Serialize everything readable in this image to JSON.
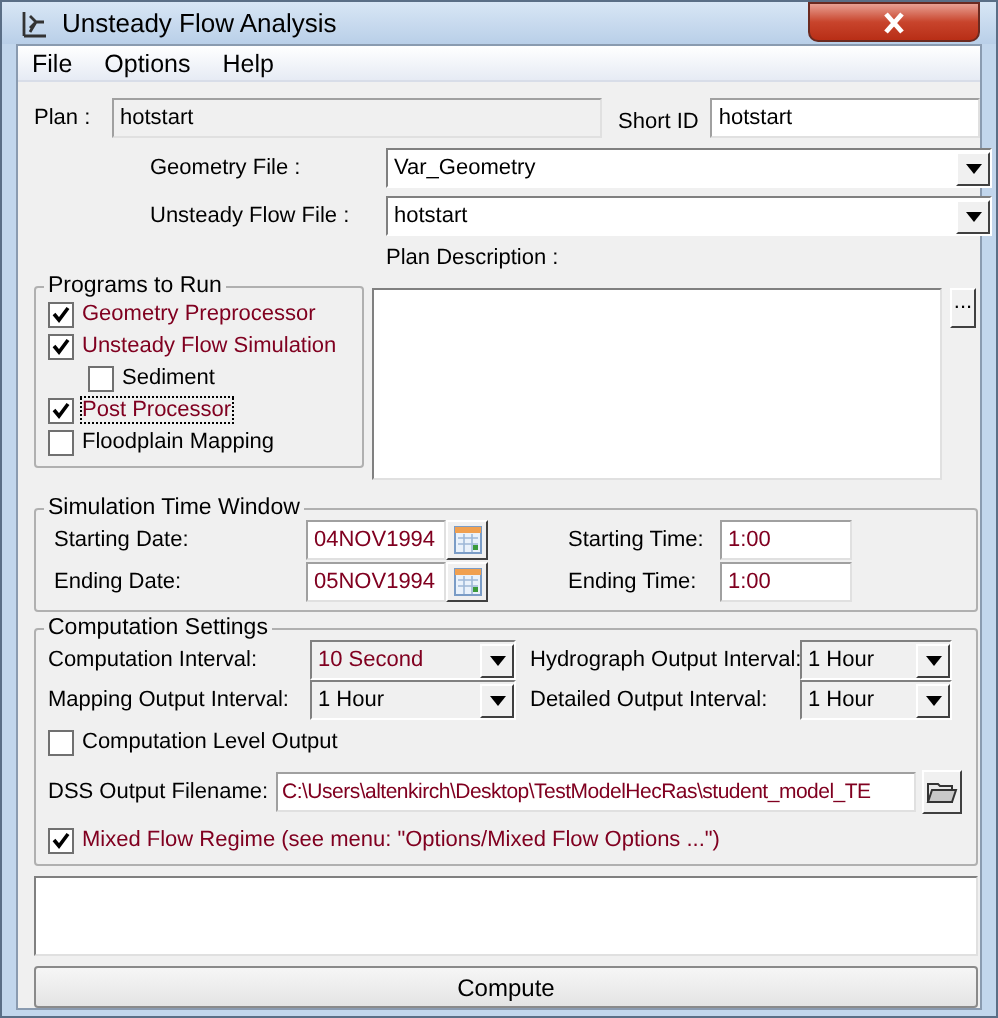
{
  "window": {
    "title": "Unsteady Flow Analysis"
  },
  "menu": [
    "File",
    "Options",
    "Help"
  ],
  "plan": {
    "label": "Plan :",
    "value": "hotstart",
    "short_id_label": "Short ID",
    "short_id": "hotstart"
  },
  "files": [
    {
      "label": "Geometry File :",
      "value": "Var_Geometry"
    },
    {
      "label": "Unsteady Flow File :",
      "value": "hotstart"
    }
  ],
  "plan_description": {
    "label": "Plan Description :",
    "button": "..."
  },
  "programs": {
    "title": "Programs to Run",
    "items": [
      {
        "label": "Geometry Preprocessor",
        "checked": true,
        "focused": false
      },
      {
        "label": "Unsteady Flow Simulation",
        "checked": true,
        "focused": false,
        "children": [
          {
            "label": "Sediment",
            "checked": false,
            "focused": false
          }
        ]
      },
      {
        "label": "Post Processor",
        "checked": true,
        "focused": true
      },
      {
        "label": "Floodplain Mapping",
        "checked": false,
        "focused": false
      }
    ]
  },
  "time_window": {
    "title": "Simulation Time Window",
    "rows": [
      {
        "date_label": "Starting Date:",
        "date": "04NOV1994",
        "time_label": "Starting Time:",
        "time": "1:00"
      },
      {
        "date_label": "Ending Date:",
        "date": "05NOV1994",
        "time_label": "Ending Time:",
        "time": "1:00"
      }
    ]
  },
  "computation": {
    "title": "Computation Settings",
    "intervals": [
      {
        "label": "Computation Interval:",
        "value": "10 Second",
        "highlighted": true
      },
      {
        "label": "Hydrograph Output Interval:",
        "value": "1 Hour",
        "highlighted": false
      },
      {
        "label": "Mapping Output Interval:",
        "value": "1 Hour",
        "highlighted": false
      },
      {
        "label": "Detailed Output Interval:",
        "value": "1 Hour",
        "highlighted": false
      }
    ],
    "level_output": {
      "label": "Computation Level Output",
      "checked": false
    },
    "dss_label": "DSS Output Filename:",
    "dss_value": "C:\\Users\\altenkirch\\Desktop\\TestModelHecRas\\student_model_TE",
    "mixed_flow": {
      "label": "Mixed Flow Regime (see menu: \"Options/Mixed Flow Options ...\")",
      "checked": true
    }
  },
  "compute_button": "Compute"
}
